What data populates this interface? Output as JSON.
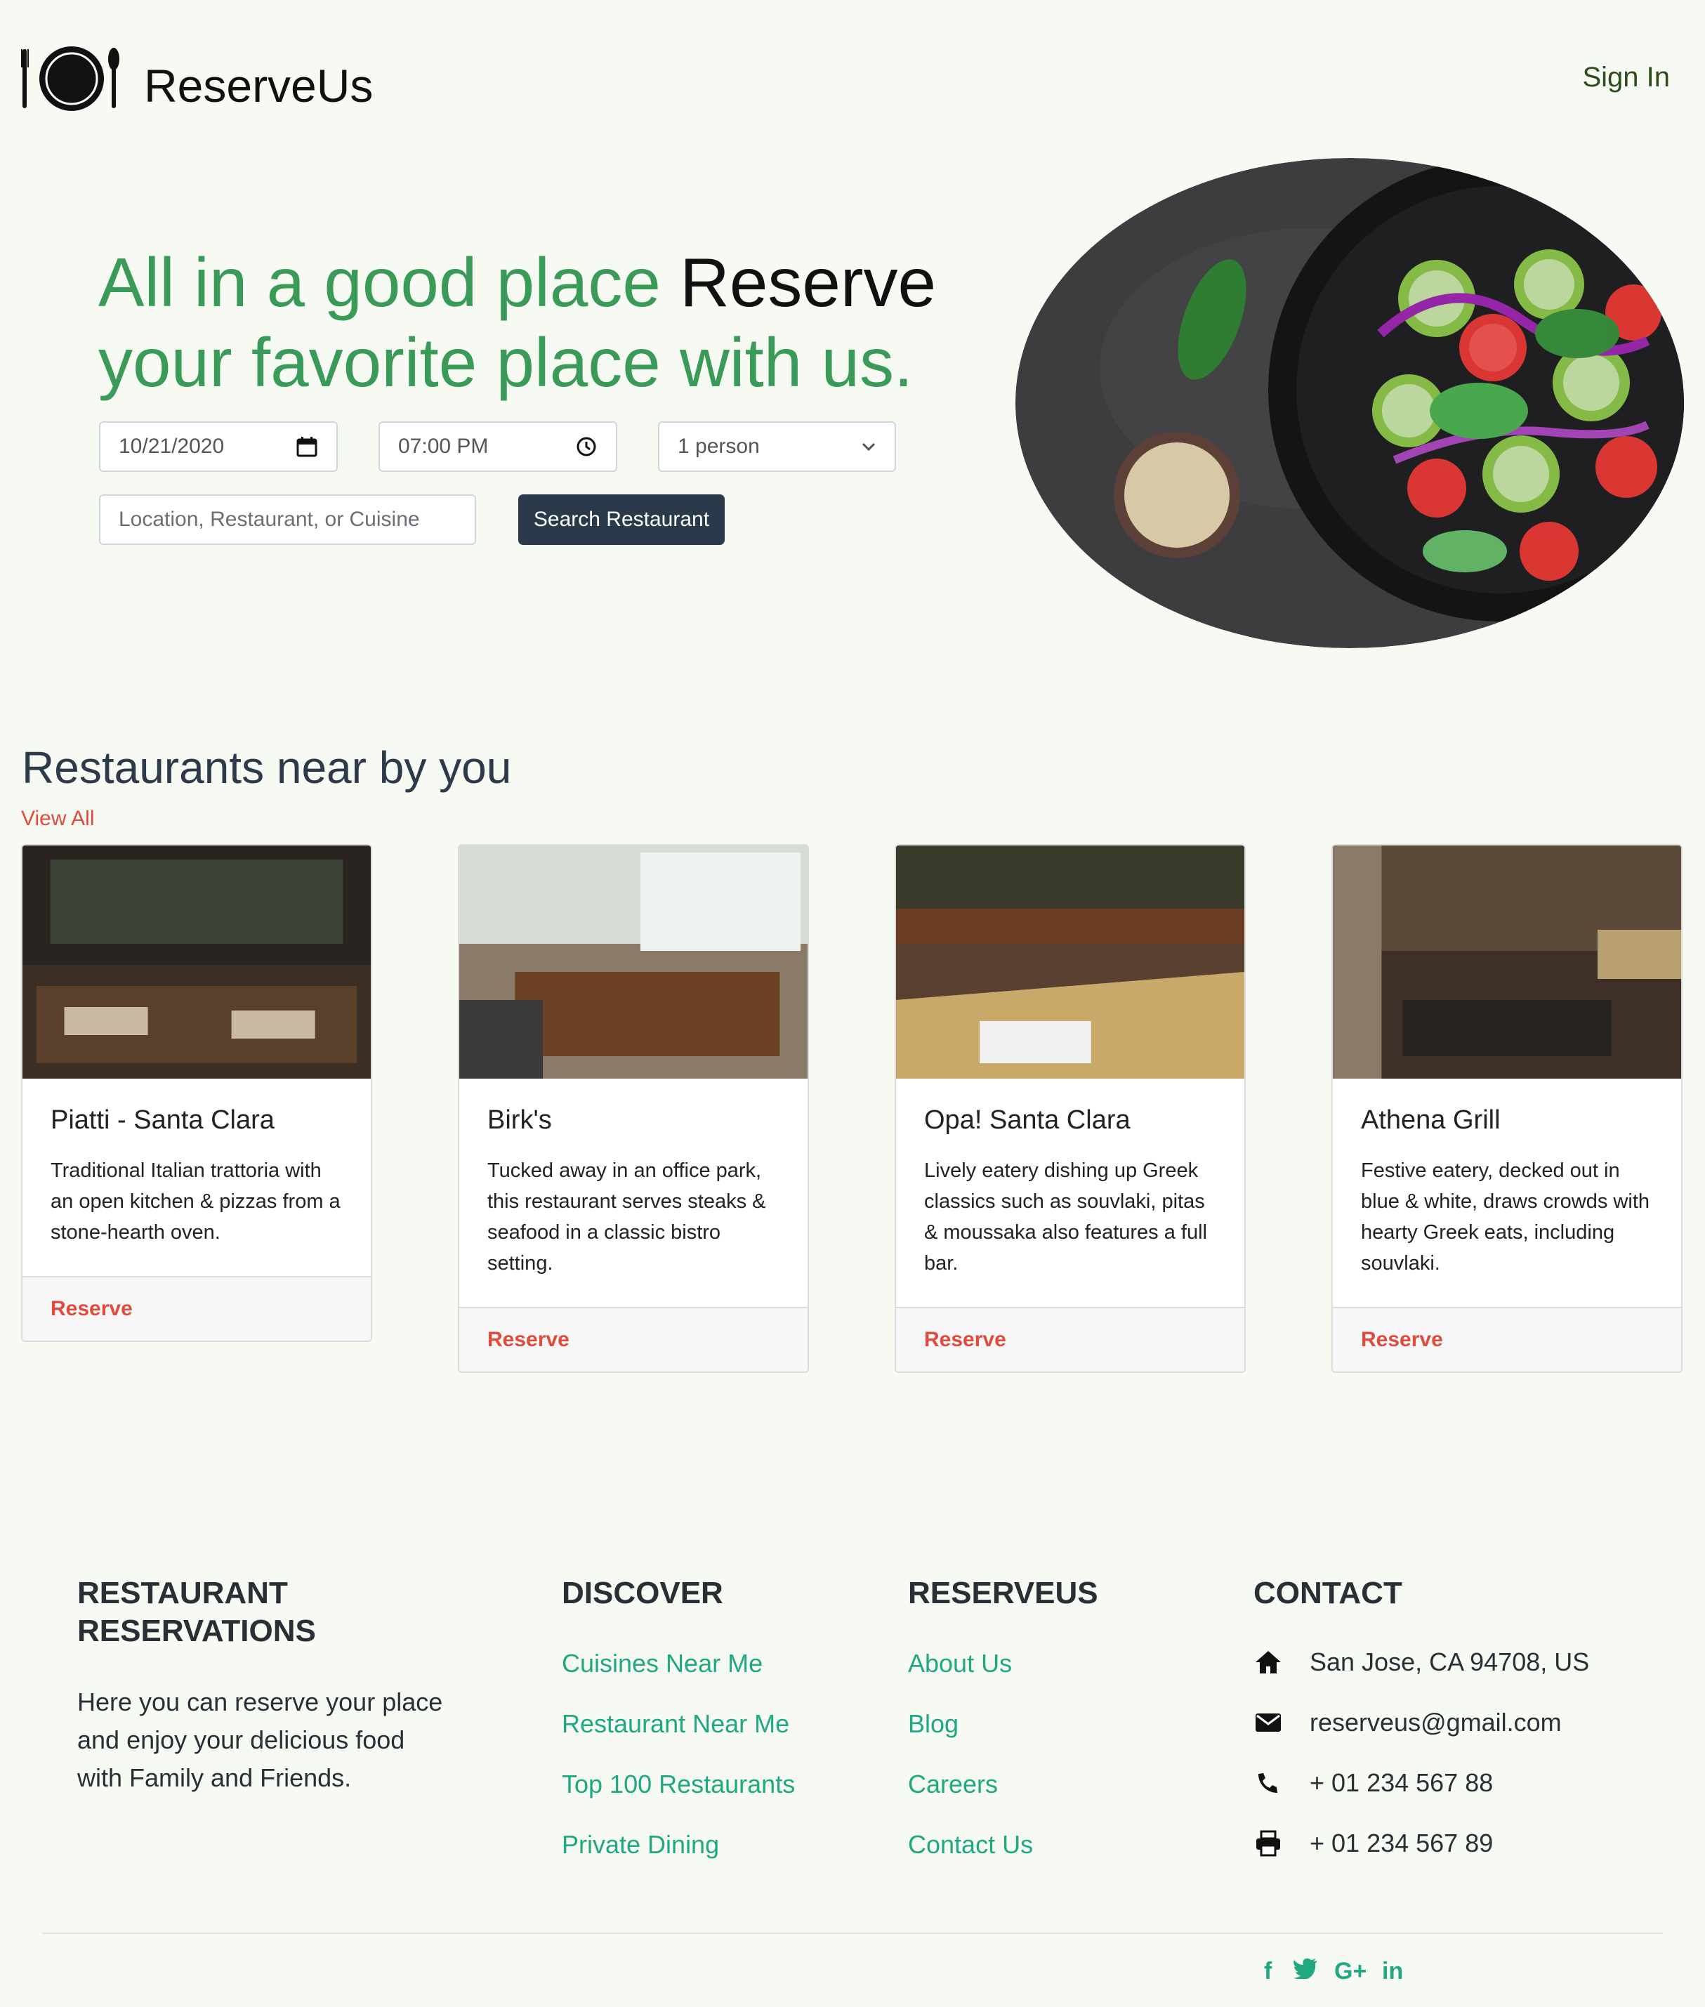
{
  "header": {
    "brand": "ReserveUs",
    "signin_label": "Sign In"
  },
  "hero": {
    "title_green_1": "All in a good place ",
    "title_dark": "Reserve",
    "title_green_2": "your favorite place with us.",
    "date_value": "10/21/2020",
    "time_value": "07:00 PM",
    "party_value": "1 person",
    "location_placeholder": "Location, Restaurant, or Cuisine",
    "search_label": "Search Restaurant"
  },
  "restaurants": {
    "section_title": "Restaurants near by you",
    "view_all_label": "View All",
    "reserve_label": "Reserve",
    "items": [
      {
        "name": "Piatti - Santa Clara",
        "desc": "Traditional Italian trattoria with an open kitchen & pizzas from a stone-hearth oven."
      },
      {
        "name": "Birk's",
        "desc": "Tucked away in an office park, this restaurant serves steaks & seafood in a classic bistro setting."
      },
      {
        "name": "Opa! Santa Clara",
        "desc": "Lively eatery dishing up Greek classics such as souvlaki, pitas & moussaka also features a full bar."
      },
      {
        "name": "Athena Grill",
        "desc": "Festive eatery, decked out in blue & white, draws crowds with hearty Greek eats, including souvlaki."
      }
    ]
  },
  "footer": {
    "col1": {
      "heading_1": "RESTAURANT",
      "heading_2": "RESERVATIONS",
      "text_1": "Here you can reserve your place",
      "text_2": "and enjoy your delicious food",
      "text_3": "with Family and Friends."
    },
    "discover": {
      "heading": "DISCOVER",
      "links": [
        "Cuisines Near Me",
        "Restaurant Near Me",
        "Top 100 Restaurants",
        "Private Dining"
      ]
    },
    "reserveus": {
      "heading": "RESERVEUS",
      "links": [
        "About Us",
        "Blog",
        "Careers",
        "Contact Us"
      ]
    },
    "contact": {
      "heading": "CONTACT",
      "address": "San Jose, CA 94708, US",
      "email": "reserveus@gmail.com",
      "phone": "+ 01 234 567 88",
      "fax": "+ 01 234 567 89"
    },
    "social": {
      "facebook": "f",
      "twitter": "t",
      "google": "G+",
      "linkedin": "in"
    }
  },
  "colors": {
    "accent_green": "#3a9a57",
    "link_teal": "#20a880",
    "reserve_red": "#e04b3c",
    "button_dark": "#2a3a4a"
  }
}
